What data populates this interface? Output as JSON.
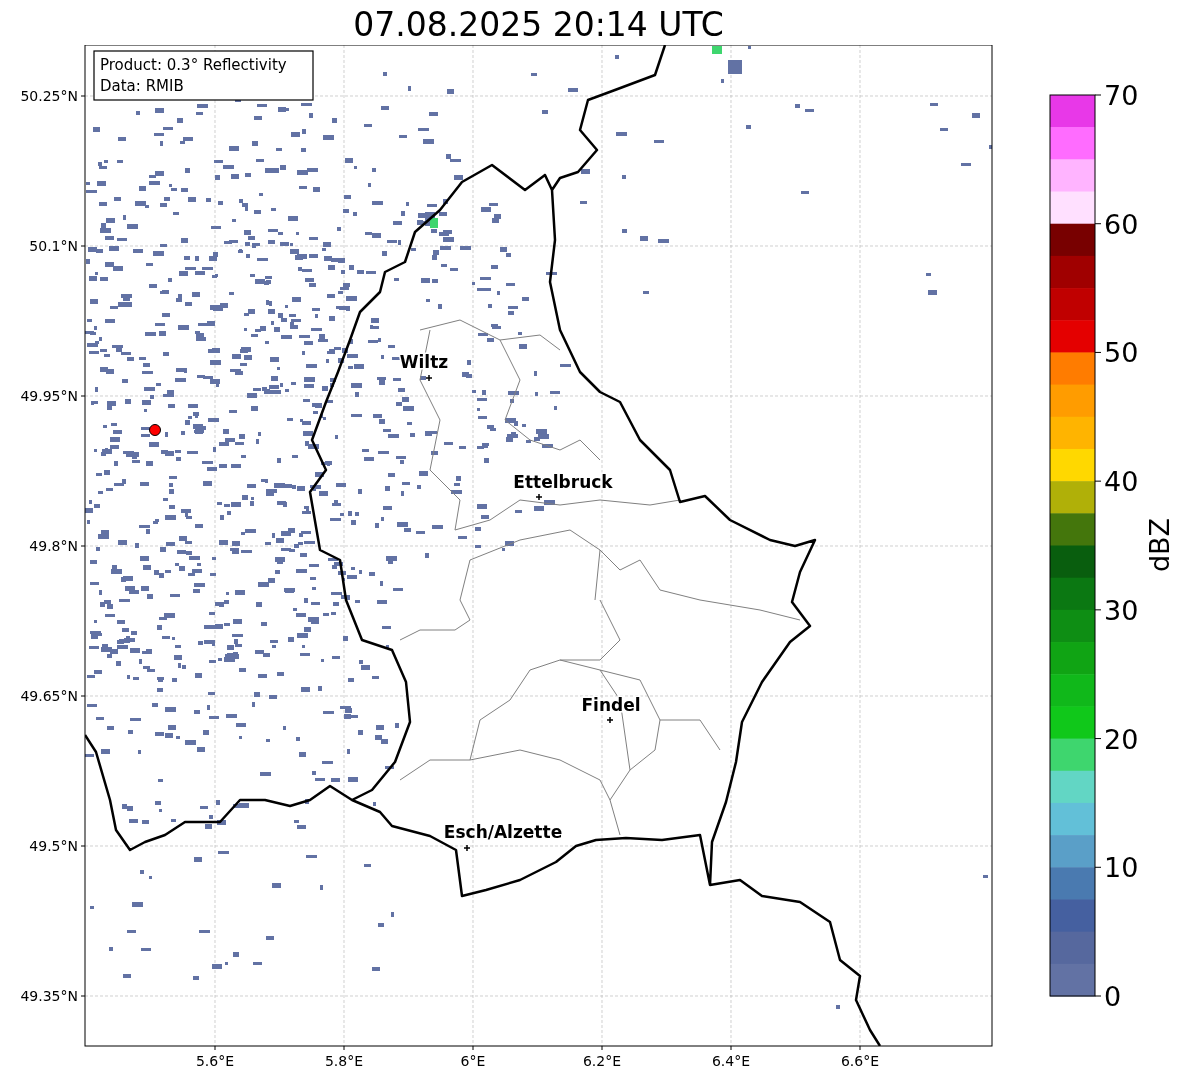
{
  "title": "07.08.2025 20:14 UTC",
  "info_box": {
    "lines": [
      "Product: 0.3° Reflectivity",
      "Data: RMIB"
    ]
  },
  "map": {
    "cities": [
      {
        "name": "Wiltz"
      },
      {
        "name": "Ettelbruck"
      },
      {
        "name": "Findel"
      },
      {
        "name": "Esch/Alzette"
      }
    ],
    "x_ticks": [
      "5.6°E",
      "5.8°E",
      "6°E",
      "6.2°E",
      "6.4°E",
      "6.6°E"
    ],
    "y_ticks": [
      "50.25°N",
      "50.1°N",
      "49.95°N",
      "49.8°N",
      "49.65°N",
      "49.5°N",
      "49.35°N"
    ]
  },
  "colorbar": {
    "label": "dBZ",
    "ticks": [
      "70",
      "60",
      "50",
      "40",
      "30",
      "20",
      "10",
      "0"
    ],
    "segments": [
      {
        "color": "#e838e8"
      },
      {
        "color": "#ff6cff"
      },
      {
        "color": "#ffb4ff"
      },
      {
        "color": "#ffe0ff"
      },
      {
        "color": "#780000"
      },
      {
        "color": "#a00000"
      },
      {
        "color": "#c00000"
      },
      {
        "color": "#e40000"
      },
      {
        "color": "#ff7c00"
      },
      {
        "color": "#ff9c00"
      },
      {
        "color": "#ffb400"
      },
      {
        "color": "#ffd800"
      },
      {
        "color": "#b0b008"
      },
      {
        "color": "#44760c"
      },
      {
        "color": "#095e0e"
      },
      {
        "color": "#0b7812"
      },
      {
        "color": "#0e8e14"
      },
      {
        "color": "#10a414"
      },
      {
        "color": "#10b81a"
      },
      {
        "color": "#10c81a"
      },
      {
        "color": "#3ed66e"
      },
      {
        "color": "#62d6c4"
      },
      {
        "color": "#62c0d8"
      },
      {
        "color": "#5a9fc8"
      },
      {
        "color": "#4a7ab0"
      },
      {
        "color": "#4560a0"
      },
      {
        "color": "#56689e"
      },
      {
        "color": "#6272a4"
      }
    ]
  }
}
